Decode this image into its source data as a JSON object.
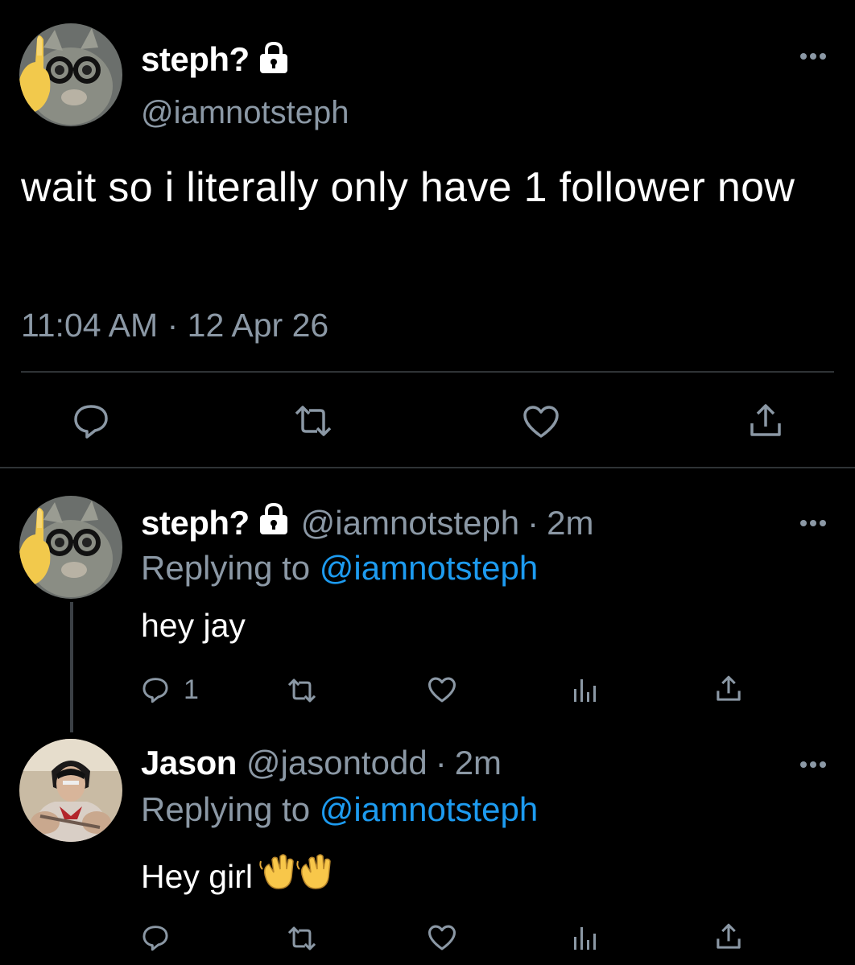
{
  "main_tweet": {
    "display_name": "steph?",
    "handle": "@iamnotsteph",
    "text": "wait so i literally only have 1 follower now",
    "time": "11:04 AM",
    "separator": "·",
    "date": "12 Apr 26",
    "icons": [
      "reply-icon",
      "retweet-icon",
      "like-icon",
      "share-icon"
    ]
  },
  "replies": [
    {
      "display_name": "steph?",
      "handle": "@iamnotsteph",
      "separator": "·",
      "time": "2m",
      "replying_prefix": "Replying to",
      "replying_to": "@iamnotsteph",
      "text": "hey jay",
      "reply_count": "1",
      "locked": true
    },
    {
      "display_name": "Jason",
      "handle": "@jasontodd",
      "separator": "·",
      "time": "2m",
      "replying_prefix": "Replying to",
      "replying_to": "@iamnotsteph",
      "text": "Hey girl",
      "emoji": "👋👋",
      "reply_count": "",
      "locked": false
    }
  ],
  "colors": {
    "background": "#000000",
    "primary_text": "#ffffff",
    "secondary_text": "#8b98a5",
    "link": "#1d9bf0",
    "divider": "#2f3336"
  }
}
